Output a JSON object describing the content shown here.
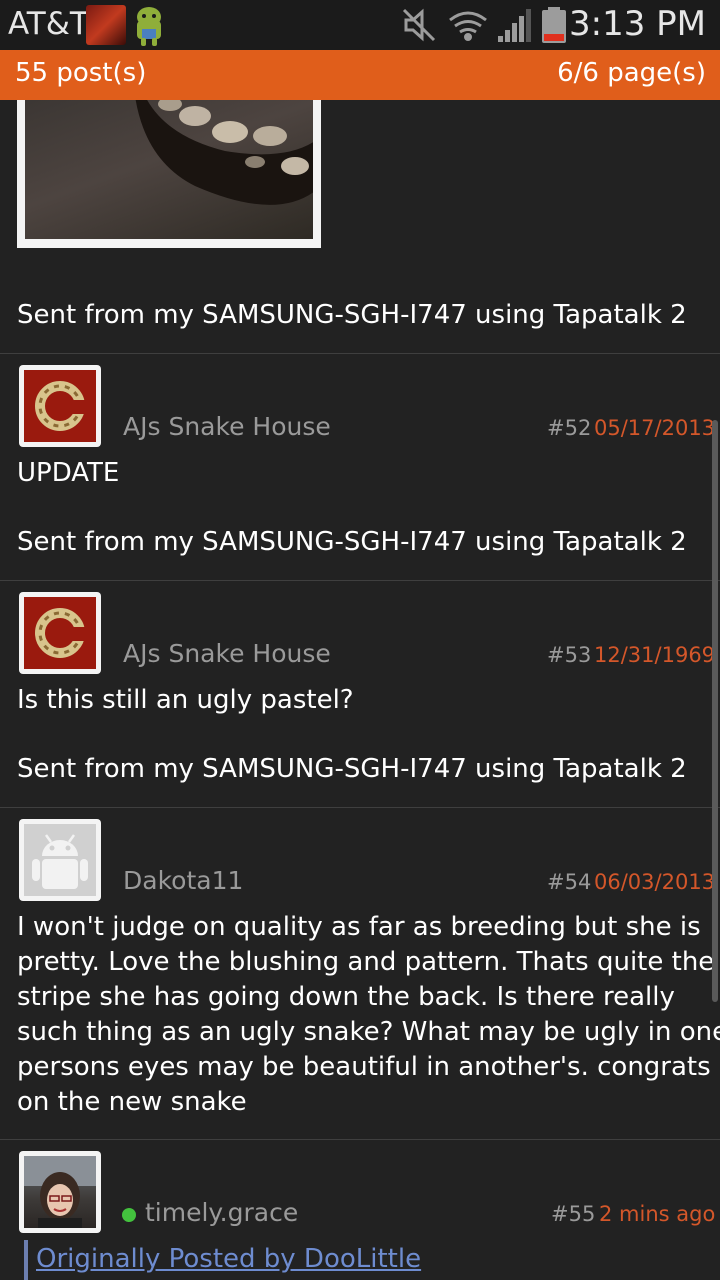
{
  "status_bar": {
    "carrier": "AT&T",
    "time": "3:13 PM",
    "icons": [
      "notification-app-icon",
      "android-app-icon",
      "mute-icon",
      "wifi-icon",
      "signal-icon",
      "battery-icon"
    ]
  },
  "header": {
    "posts": "55 post(s)",
    "pages": "6/6 page(s)"
  },
  "posts": [
    {
      "signature": "Sent from my SAMSUNG-SGH-I747 using Tapatalk 2"
    },
    {
      "author": "AJs Snake House",
      "number": "#52",
      "date": "05/17/2013",
      "body": [
        "UPDATE"
      ],
      "signature": "Sent from my SAMSUNG-SGH-I747 using Tapatalk 2"
    },
    {
      "author": "AJs Snake House",
      "number": "#53",
      "date": "12/31/1969",
      "body": [
        "Is this still an ugly pastel?"
      ],
      "signature": "Sent from my SAMSUNG-SGH-I747 using Tapatalk 2"
    },
    {
      "author": "Dakota11",
      "number": "#54",
      "date": "06/03/2013",
      "body": [
        "I won't judge on quality as far as breeding but she is",
        "pretty. Love the blushing and pattern. Thats quite the",
        "stripe she has going down the back. Is there really",
        "such thing as an ugly snake? What may be ugly in one",
        "persons eyes may be beautiful in another's. congrats",
        "on the new snake"
      ]
    },
    {
      "author": "timely.grace",
      "number": "#55",
      "date": "2 mins ago",
      "quote": "Originally Posted by DooLittle"
    }
  ],
  "colors": {
    "accent": "#e05e1b",
    "background": "#222222",
    "date": "#d4572a",
    "username": "#9a9a9a",
    "link": "#6e8cd0",
    "online": "#43c23e"
  }
}
